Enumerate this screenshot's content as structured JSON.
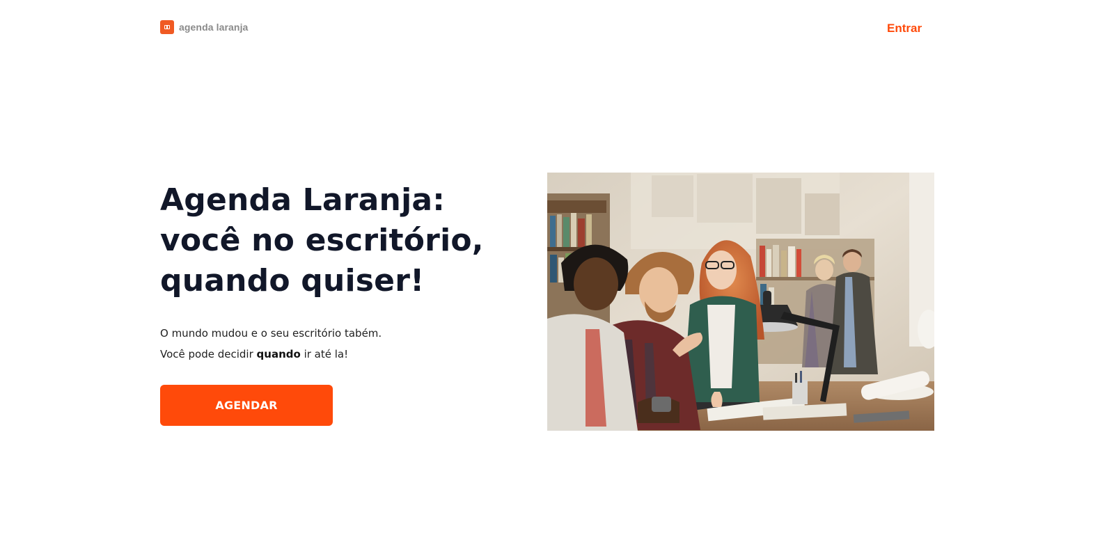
{
  "brand": {
    "name": "agenda laranja",
    "accent_color": "#ff4a0a",
    "logo_color": "#f05a23",
    "logo_icon": "calendar-icon"
  },
  "header": {
    "login_label": "Entrar"
  },
  "hero": {
    "title_lines": [
      "Agenda Laranja:",
      "você no escritório,",
      "quando quiser!"
    ],
    "description_line1": "O mundo mudou e o seu escritório tabém.",
    "description_line2_prefix": "Você pode decidir ",
    "description_line2_bold": "quando",
    "description_line2_suffix": " ir até la!",
    "cta_label": "AGENDAR",
    "image_subject": "team-working-in-office-photo"
  }
}
